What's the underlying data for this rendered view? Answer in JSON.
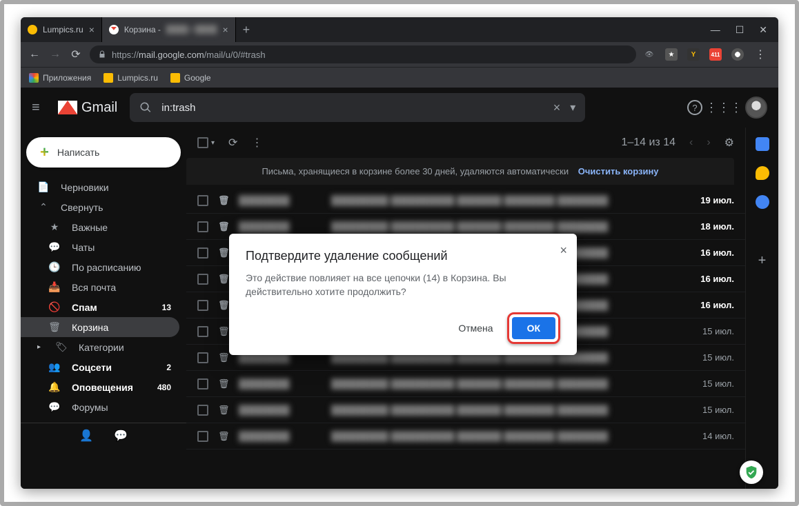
{
  "browser": {
    "tabs": [
      {
        "title": "Lumpics.ru",
        "favColor": "#fbbc04"
      },
      {
        "title": "Корзина -",
        "favColor": "#ea4335"
      }
    ],
    "url_prefix": "https://",
    "url_host": "mail.google.com",
    "url_path": "/mail/u/0/#trash",
    "bookmarks_btn": "Приложения",
    "bookmarks": [
      {
        "label": "Lumpics.ru",
        "color": "#fbbc04"
      },
      {
        "label": "Google",
        "color": "#fbbc04"
      }
    ],
    "ext_badge": "411"
  },
  "gmail": {
    "brand": "Gmail",
    "search_value": "in:trash",
    "compose": "Написать",
    "nav": [
      {
        "icon": "file-icon",
        "label": "Черновики"
      },
      {
        "icon": "chevron-up-icon",
        "label": "Свернуть"
      },
      {
        "icon": "star-icon",
        "label": "Важные",
        "sub": true
      },
      {
        "icon": "chat-icon",
        "label": "Чаты",
        "sub": true
      },
      {
        "icon": "clock-icon",
        "label": "По расписанию",
        "sub": true
      },
      {
        "icon": "stack-icon",
        "label": "Вся почта",
        "sub": true
      },
      {
        "icon": "spam-icon",
        "label": "Спам",
        "count": "13",
        "sub": true,
        "bold": true
      },
      {
        "icon": "trash-icon",
        "label": "Корзина",
        "sub": true,
        "active": true
      },
      {
        "icon": "tag-icon",
        "label": "Категории",
        "expand": true
      },
      {
        "icon": "people-icon",
        "label": "Соцсети",
        "count": "2",
        "sub": true,
        "bold": true
      },
      {
        "icon": "bell-icon",
        "label": "Оповещения",
        "count": "480",
        "sub": true,
        "bold": true
      },
      {
        "icon": "forum-icon",
        "label": "Форумы",
        "sub": true
      }
    ],
    "toolbar": {
      "range": "1–14 из 14"
    },
    "banner_text": "Письма, хранящиеся в корзине более 30 дней, удаляются автоматически",
    "banner_action": "Очистить корзину",
    "rows": [
      {
        "date": "19 июл.",
        "bold": true
      },
      {
        "date": "18 июл.",
        "bold": true
      },
      {
        "date": "16 июл.",
        "bold": true
      },
      {
        "date": "16 июл.",
        "bold": true
      },
      {
        "date": "16 июл.",
        "bold": true
      },
      {
        "date": "15 июл."
      },
      {
        "date": "15 июл."
      },
      {
        "date": "15 июл."
      },
      {
        "date": "15 июл."
      },
      {
        "date": "14 июл."
      }
    ]
  },
  "dialog": {
    "title": "Подтвердите удаление сообщений",
    "body": "Это действие повлияет на все цепочки (14) в Корзина. Вы действительно хотите продолжить?",
    "cancel": "Отмена",
    "ok": "ОК"
  }
}
